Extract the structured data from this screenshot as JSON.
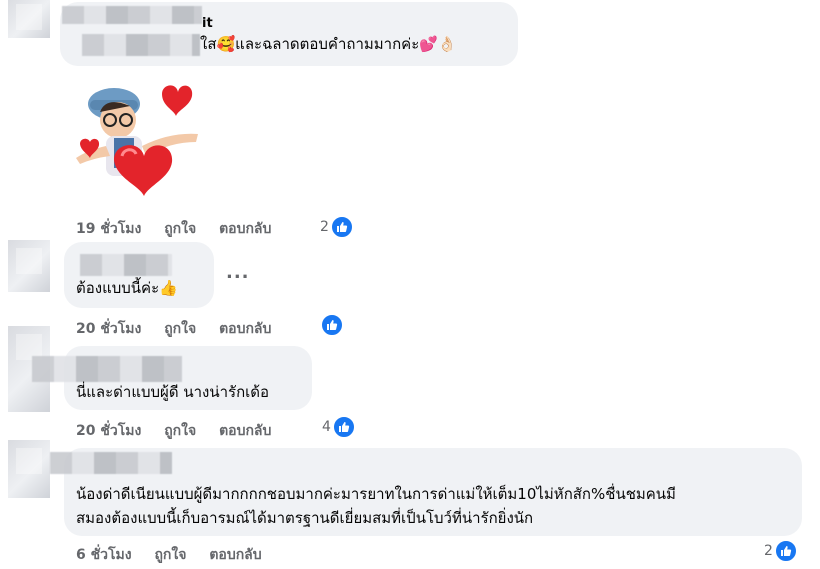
{
  "comments": [
    {
      "name_visible": "it",
      "text": "ใส🥰และฉลาดตอบคำถามมากค่ะ💕👌🏻",
      "time": "19 ชั่วโมง",
      "like_label": "ถูกใจ",
      "reply_label": "ตอบกลับ",
      "reaction_count": "2"
    },
    {
      "text": "ต้องแบบนี้ค่ะ👍",
      "time": "20 ชั่วโมง",
      "like_label": "ถูกใจ",
      "reply_label": "ตอบกลับ",
      "reaction_count": "",
      "more": "..."
    },
    {
      "text": "นี่และด่าแบบผู้ดี นางน่ารักเด้อ",
      "time": "20 ชั่วโมง",
      "like_label": "ถูกใจ",
      "reply_label": "ตอบกลับ",
      "reaction_count": "4"
    },
    {
      "text_line1": "น้องด่าดีเนียนแบบผู้ดีมากกกกชอบมากค่ะมารยาทในการด่าแม่ให้เต็ม10ไม่หักสัก%ชื่นชมคนมี",
      "text_line2": "สมองต้องแบบนี้เก็บอารมณ์ได้มาตรฐานดีเยี่ยมสมที่เป็นโบว์ที่น่ารักยิ่งนัก",
      "time": "6 ชั่วโมง",
      "like_label": "ถูกใจ",
      "reply_label": "ตอบกลับ",
      "reaction_count": "2"
    }
  ],
  "colors": {
    "like_blue": "#1877f2",
    "bubble": "#f0f2f5",
    "meta": "#65676b"
  },
  "icons": {
    "reaction": "like-thumb-icon",
    "sticker": "avatar-heart-sticker"
  }
}
